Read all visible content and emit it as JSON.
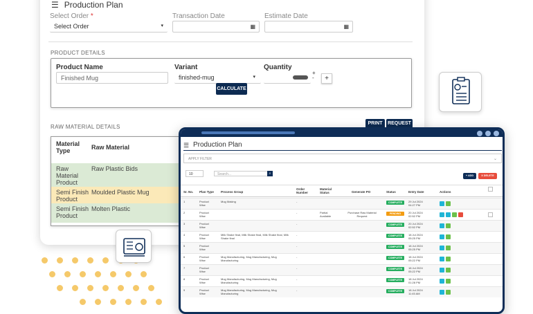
{
  "back": {
    "title": "Production Plan",
    "select_order_label": "Select Order",
    "req": "*",
    "select_order_value": "Select Order",
    "transaction_label": "Transaction Date",
    "estimate_label": "Estimate Date",
    "product_details": "PRODUCT DETAILS",
    "product_name_label": "Product Name",
    "product_name_value": "Finished Mug",
    "variant_label": "Variant",
    "variant_value": "finished-mug",
    "quantity_label": "Quantity",
    "calculate": "CALCULATE",
    "print": "PRINT",
    "request": "REQUEST",
    "raw_details": "RAW MATERIAL DETAILS",
    "raw_headers": [
      "Material Type",
      "Raw Material"
    ],
    "raw_rows": [
      {
        "type": "Raw Material Product",
        "name": "Raw Plastic Bids",
        "color": "#dbead5"
      },
      {
        "type": "Semi Finish Product",
        "name": "Moulded Plastic Mug",
        "color": "#fbe9b8"
      },
      {
        "type": "Semi Finish Product",
        "name": "Molten Plastic",
        "color": "#dbead5"
      }
    ]
  },
  "front": {
    "title": "Production Plan",
    "filter": "APPLY FILTER",
    "page_size": "10",
    "search_placeholder": "Search...",
    "add": "+ ADD",
    "delete": "X DELETE",
    "headers": [
      "Sr. No.",
      "Plan Type",
      "Process Group",
      "Order Number",
      "Material Status",
      "Generate PO",
      "Status",
      "Entry Date",
      "Actions"
    ],
    "rows": [
      {
        "no": "1",
        "type": "Product Wise",
        "group": "Mug Making",
        "order": "-",
        "mat": "",
        "po": "",
        "status": "COMPLETE",
        "date": "29 Jul 2024",
        "time": "04:27 PM"
      },
      {
        "no": "2",
        "type": "Product Wise",
        "group": "",
        "order": "-",
        "mat": "Partial Available",
        "po": "Purchase Raw Material Request",
        "status": "PENDING",
        "date": "20 Jul 2024",
        "time": "02:52 PM"
      },
      {
        "no": "3",
        "type": "Product Wise",
        "group": "",
        "order": "-",
        "mat": "",
        "po": "",
        "status": "COMPLETE",
        "date": "20 Jul 2024",
        "time": "02:52 PM"
      },
      {
        "no": "4",
        "type": "Product Wise",
        "group": "Milk Shake final, Milk Shake final, Milk Shake final, Milk Shake final",
        "order": "-",
        "mat": "",
        "po": "",
        "status": "COMPLETE",
        "date": "18 Jul 2024",
        "time": "05:25 PM"
      },
      {
        "no": "5",
        "type": "Product Wise",
        "group": "",
        "order": "-",
        "mat": "",
        "po": "",
        "status": "COMPLETE",
        "date": "18 Jul 2024",
        "time": "05:25 PM"
      },
      {
        "no": "6",
        "type": "Product Wise",
        "group": "Mug Manufacturing, Mug Manufacturing, Mug Manufacturing",
        "order": "-",
        "mat": "",
        "po": "",
        "status": "COMPLETE",
        "date": "18 Jul 2024",
        "time": "05:22 PM"
      },
      {
        "no": "7",
        "type": "Product Wise",
        "group": "",
        "order": "-",
        "mat": "",
        "po": "",
        "status": "COMPLETE",
        "date": "18 Jul 2024",
        "time": "05:22 PM"
      },
      {
        "no": "8",
        "type": "Product Wise",
        "group": "Mug Manufacturing, Mug Manufacturing, Mug Manufacturing",
        "order": "-",
        "mat": "",
        "po": "",
        "status": "COMPLETE",
        "date": "18 Jul 2024",
        "time": "01:28 PM"
      },
      {
        "no": "9",
        "type": "Product Wise",
        "group": "Mug Manufacturing, Mug Manufacturing, Mug Manufacturing",
        "order": "-",
        "mat": "",
        "po": "",
        "status": "COMPLETE",
        "date": "18 Jul 2024",
        "time": "11:45 AM"
      }
    ]
  },
  "colors": {
    "navy": "#0e2d57",
    "complete": "#27ae60",
    "pending": "#f39c12",
    "view": "#1fb5d6",
    "edit": "#6cc04a",
    "delete": "#e74c3c",
    "dots": "#f5c96a"
  }
}
